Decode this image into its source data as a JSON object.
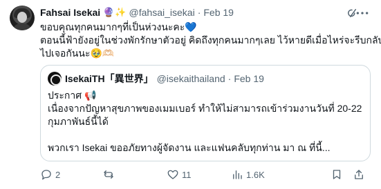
{
  "post": {
    "display_name": "Fahsai Isekai",
    "badges": [
      "🔮",
      "✨"
    ],
    "handle": "@fahsai_isekai",
    "separator": "·",
    "time": "Feb 19",
    "text_lines": [
      "ขอบคุณทุกคนมากๆที่เป็นห่วงนะคะ💙",
      "ตอนนี้ฟ้ายังอยู่ในช่วงพักรักษาตัวอยู่ คิดถึงทุกคนมากๆเลย ไว้หายดีเมื่อไหร่จะรีบกลับ",
      "ไปเจอกันนะ🥹🫶🏻"
    ]
  },
  "quote": {
    "display_name": "IsekaiTH「異世界」",
    "handle": "@isekaithailand",
    "separator": "·",
    "time": "Feb 19",
    "text_lines": [
      "ประกาศ 📢",
      "เนื่องจากปัญหาสุขภาพของเมมเบอร์ ทำให้ไม่สามารถเข้าร่วมงานวันที่ 20-22",
      "กุมภาพันธ์นี้ได้",
      "",
      "พวกเรา Isekai ขออภัยทางผู้จัดงาน และแฟนคลับทุกท่าน มา ณ ที่นี้..."
    ]
  },
  "actions": {
    "reply_count": "2",
    "retweet_count": "",
    "like_count": "11",
    "views_count": "1.6K"
  },
  "icons": {
    "more": "more-horizontal-icon",
    "grok": "grok-icon",
    "reply": "reply-icon",
    "retweet": "retweet-icon",
    "like": "heart-icon",
    "views": "views-chart-icon",
    "bookmark": "bookmark-icon",
    "share": "share-icon"
  },
  "colors": {
    "text": "#0f1419",
    "secondary": "#536471",
    "border": "#cfd9de",
    "background": "#ffffff"
  }
}
